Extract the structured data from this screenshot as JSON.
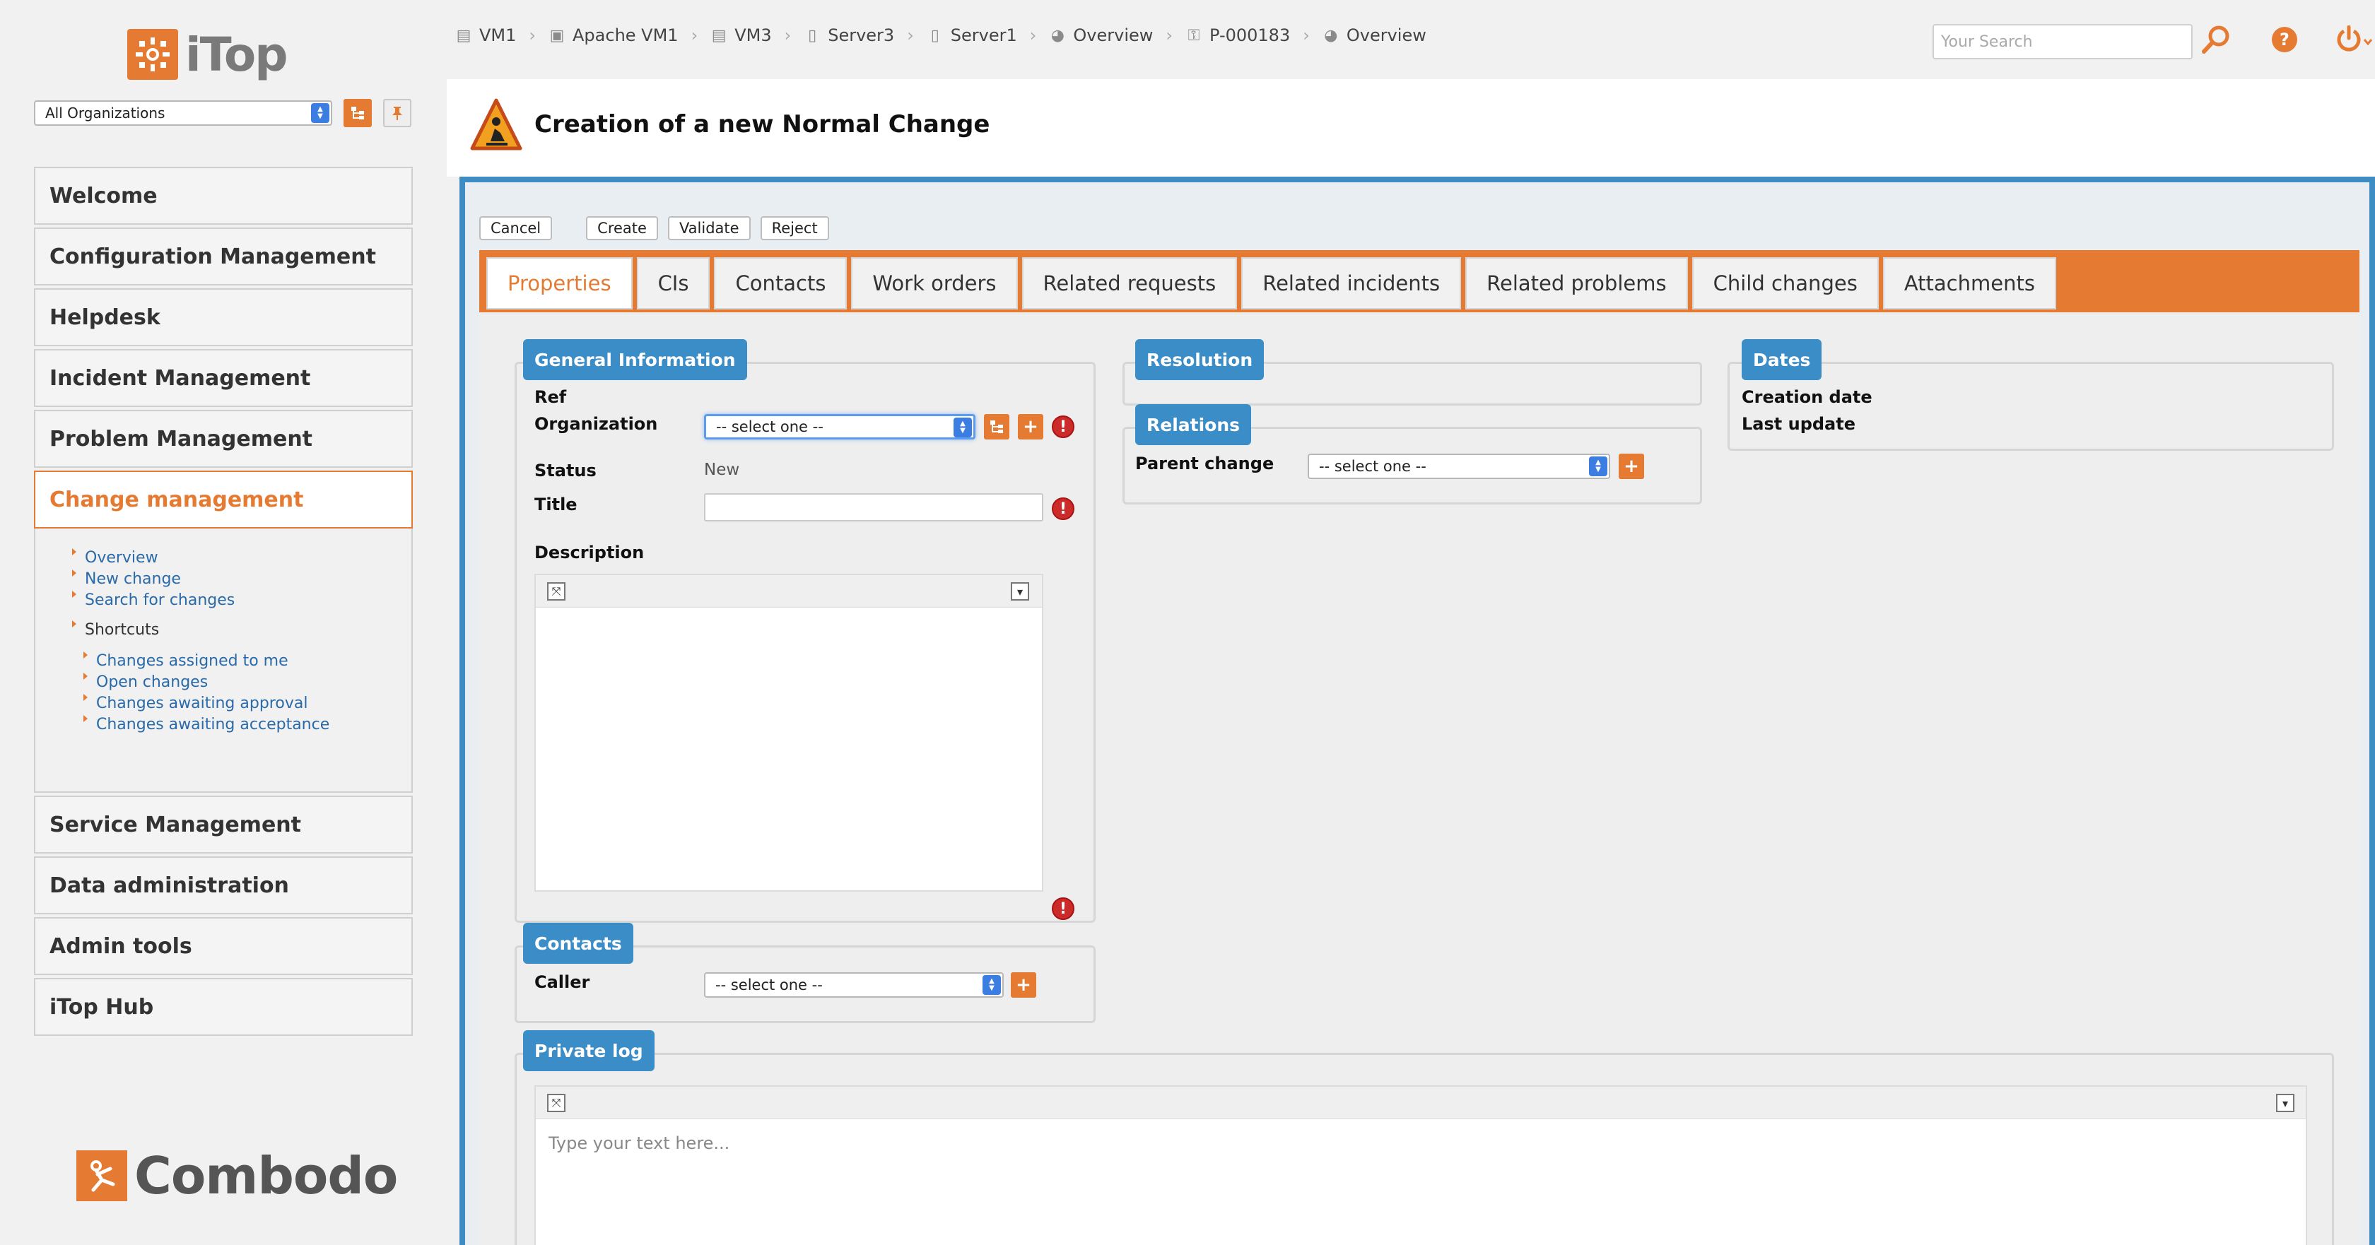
{
  "app": {
    "logo_text": "iTop",
    "vendor_text": "Combodo"
  },
  "sidebar": {
    "org_select": "All Organizations",
    "menu": [
      "Welcome",
      "Configuration Management",
      "Helpdesk",
      "Incident Management",
      "Problem Management",
      "Change management",
      "Service Management",
      "Data administration",
      "Admin tools",
      "iTop Hub"
    ],
    "change_submenu": {
      "links": [
        "Overview",
        "New change",
        "Search for changes"
      ],
      "shortcuts_label": "Shortcuts",
      "shortcuts": [
        "Changes assigned to me",
        "Open changes",
        "Changes awaiting approval",
        "Changes awaiting acceptance"
      ]
    }
  },
  "breadcrumb": [
    {
      "label": "VM1",
      "icon": "server-icon"
    },
    {
      "label": "Apache VM1",
      "icon": "app-server-icon"
    },
    {
      "label": "VM3",
      "icon": "server-icon"
    },
    {
      "label": "Server3",
      "icon": "server-tower-icon"
    },
    {
      "label": "Server1",
      "icon": "server-tower-icon"
    },
    {
      "label": "Overview",
      "icon": "pie-chart-icon"
    },
    {
      "label": "P-000183",
      "icon": "key-icon"
    },
    {
      "label": "Overview",
      "icon": "pie-chart-icon"
    }
  ],
  "search": {
    "placeholder": "Your Search"
  },
  "page": {
    "title": "Creation of a new Normal Change"
  },
  "actions": {
    "cancel": "Cancel",
    "create": "Create",
    "validate": "Validate",
    "reject": "Reject"
  },
  "tabs": [
    "Properties",
    "CIs",
    "Contacts",
    "Work orders",
    "Related requests",
    "Related incidents",
    "Related problems",
    "Child changes",
    "Attachments"
  ],
  "general": {
    "legend": "General Information",
    "ref_label": "Ref",
    "org_label": "Organization",
    "org_value": "-- select one --",
    "status_label": "Status",
    "status_value": "New",
    "title_label": "Title",
    "description_label": "Description"
  },
  "resolution": {
    "legend": "Resolution"
  },
  "relations": {
    "legend": "Relations",
    "parent_label": "Parent change",
    "parent_value": "-- select one --"
  },
  "dates": {
    "legend": "Dates",
    "creation_label": "Creation date",
    "update_label": "Last update"
  },
  "contacts": {
    "legend": "Contacts",
    "caller_label": "Caller",
    "caller_value": "-- select one --"
  },
  "private_log": {
    "legend": "Private log",
    "placeholder": "Type your text here..."
  },
  "colors": {
    "accent": "#e57b33",
    "blue": "#3b8dc7",
    "error": "#cc2b2b"
  }
}
